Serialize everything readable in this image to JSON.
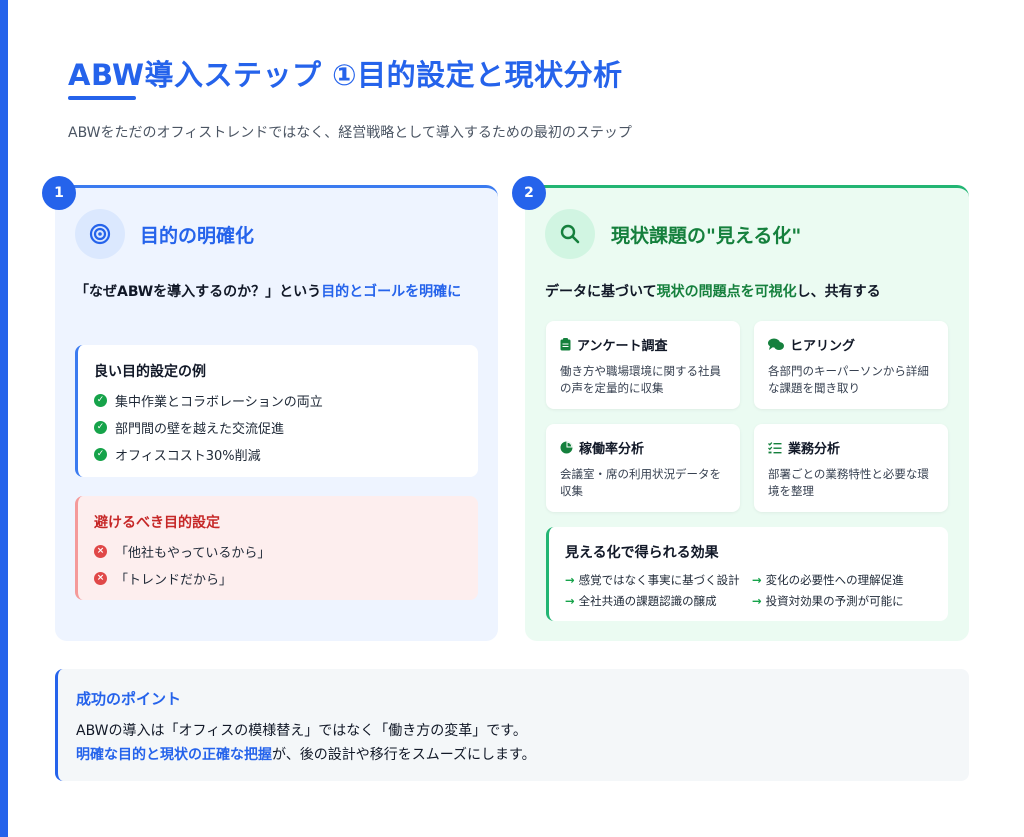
{
  "page": {
    "title": "ABW導入ステップ ①目的設定と現状分析",
    "subtitle": "ABWをただのオフィストレンドではなく、経営戦略として導入するための最初のステップ"
  },
  "colors": {
    "accent_blue": "#2563eb",
    "accent_green": "#22b573",
    "danger": "#c62828"
  },
  "step1": {
    "number": "1",
    "icon": "target-icon",
    "title": "目的の明確化",
    "lead_prefix": "「なぜABWを導入するのか？」という",
    "lead_highlight": "目的とゴールを明確に",
    "good": {
      "title": "良い目的設定の例",
      "items": [
        "集中作業とコラボレーションの両立",
        "部門間の壁を越えた交流促進",
        "オフィスコスト30%削減"
      ]
    },
    "bad": {
      "title": "避けるべき目的設定",
      "items": [
        "「他社もやっているから」",
        "「トレンドだから」"
      ]
    }
  },
  "step2": {
    "number": "2",
    "icon": "search-icon",
    "title": "現状課題の\"見える化\"",
    "lead_prefix": "データに基づいて",
    "lead_highlight": "現状の問題点を可視化",
    "lead_suffix": "し、共有する",
    "methods": [
      {
        "icon": "clipboard-icon",
        "title": "アンケート調査",
        "desc": "働き方や職場環境に関する社員の声を定量的に収集"
      },
      {
        "icon": "chat-icon",
        "title": "ヒアリング",
        "desc": "各部門のキーパーソンから詳細な課題を聞き取り"
      },
      {
        "icon": "pie-chart-icon",
        "title": "稼働率分析",
        "desc": "会議室・席の利用状況データを収集"
      },
      {
        "icon": "task-list-icon",
        "title": "業務分析",
        "desc": "部署ごとの業務特性と必要な環境を整理"
      }
    ],
    "effects": {
      "title": "見える化で得られる効果",
      "items": [
        "感覚ではなく事実に基づく設計",
        "変化の必要性への理解促進",
        "全社共通の課題認識の醸成",
        "投資対効果の予測が可能に"
      ]
    }
  },
  "point": {
    "title": "成功のポイント",
    "line1": "ABWの導入は「オフィスの模様替え」ではなく「働き方の変革」です。",
    "line2_highlight": "明確な目的と現状の正確な把握",
    "line2_suffix": "が、後の設計や移行をスムーズにします。"
  }
}
